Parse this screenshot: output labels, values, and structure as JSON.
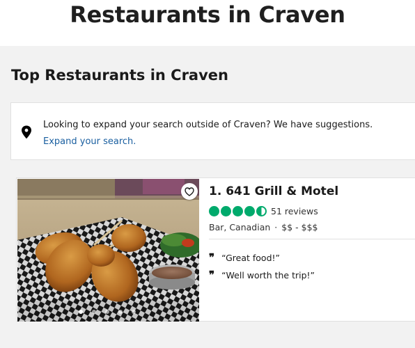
{
  "page": {
    "title": "Restaurants in Craven"
  },
  "section": {
    "title": "Top Restaurants in Craven"
  },
  "suggestion": {
    "text": "Looking to expand your search outside of Craven? We have suggestions.",
    "link": "Expand your search."
  },
  "restaurant": {
    "name": "1. 641 Grill & Motel",
    "rating": 4.5,
    "reviews": "51 reviews",
    "cuisine": "Bar, Canadian",
    "price": "$$ - $$$",
    "quotes": [
      "“Great food!”",
      "“Well worth the trip!”"
    ],
    "photo_count": 5,
    "photo_active": 0
  },
  "colors": {
    "rating_green": "#00aa6c",
    "link_blue": "#1a5fa0"
  },
  "icons": {
    "location": "map-pin-icon",
    "favorite": "heart-icon",
    "quote": "quote-mark-icon"
  }
}
